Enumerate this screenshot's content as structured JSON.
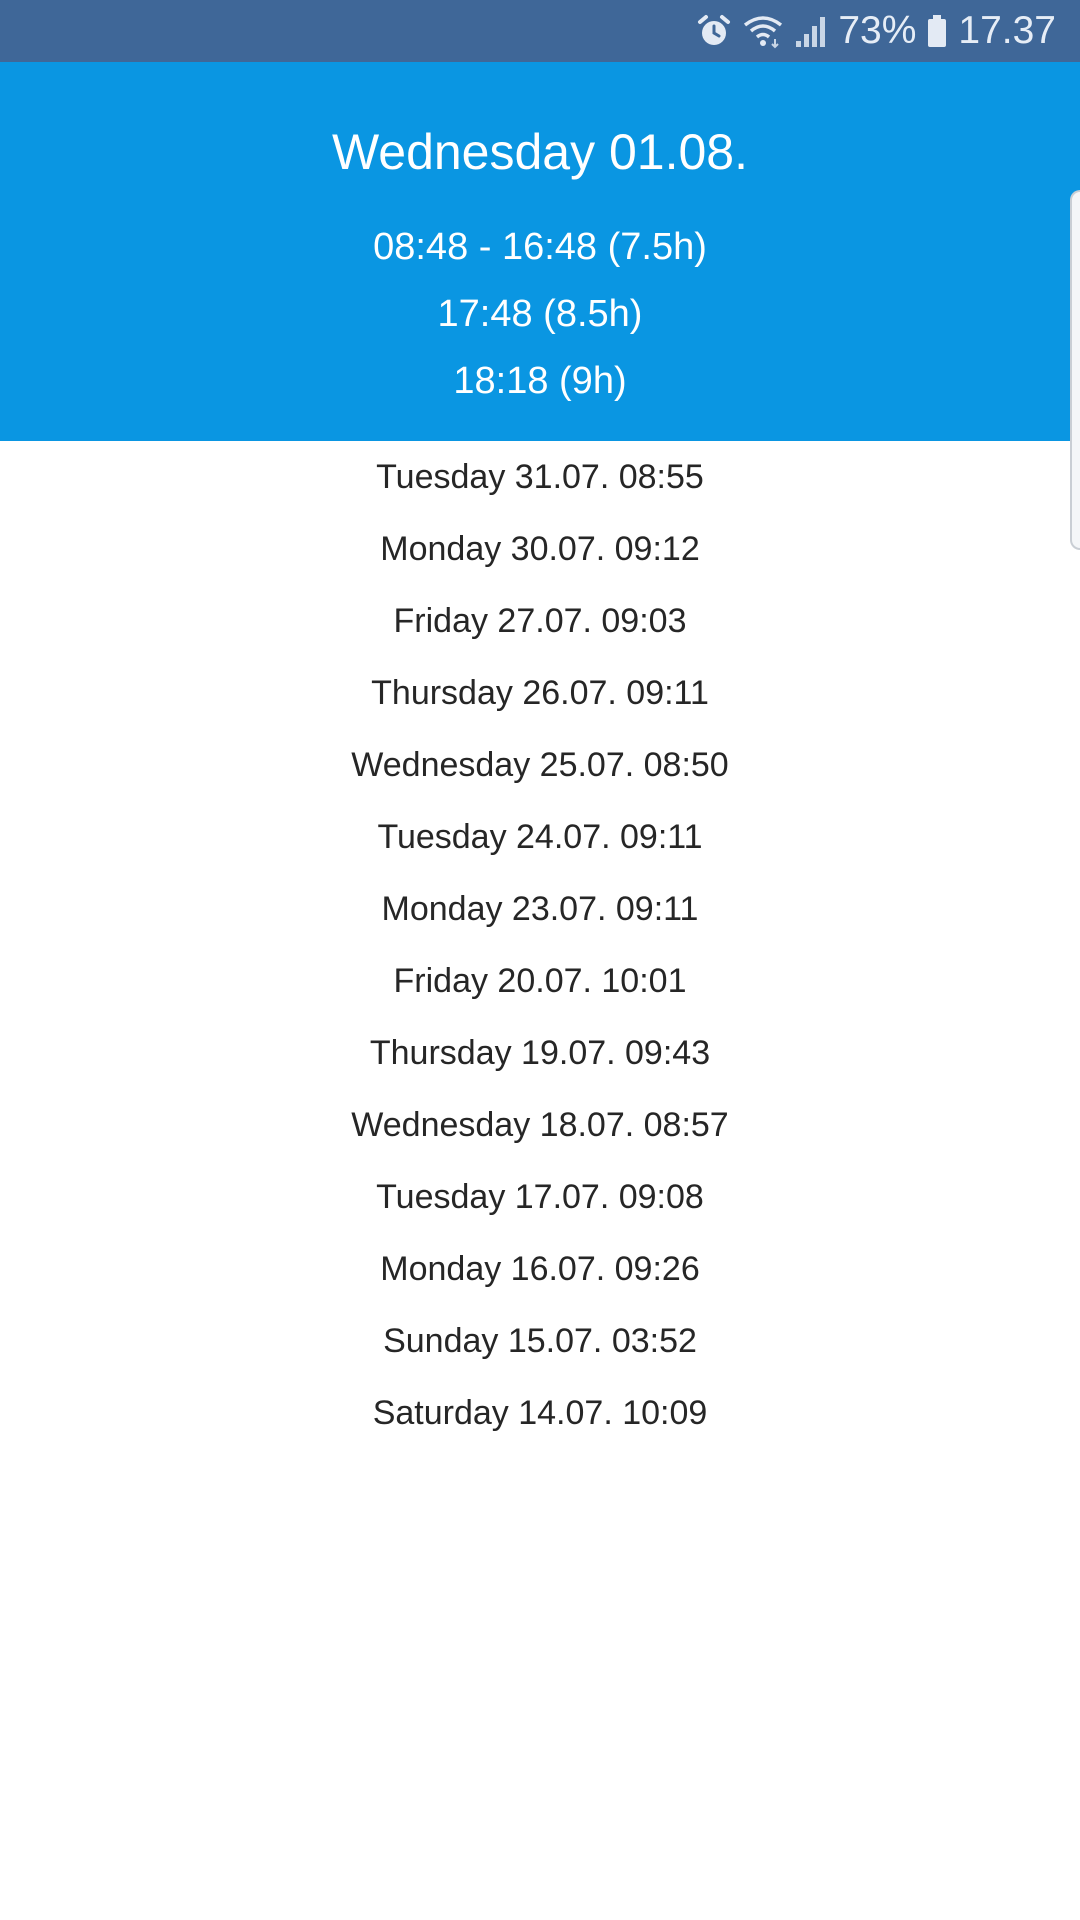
{
  "status_bar": {
    "battery_percent": "73%",
    "time": "17.37",
    "icons": [
      "alarm-icon",
      "wifi-icon",
      "signal-icon",
      "battery-icon"
    ]
  },
  "header": {
    "title": "Wednesday 01.08.",
    "lines": [
      "08:48 - 16:48 (7.5h)",
      "17:48 (8.5h)",
      "18:18 (9h)"
    ]
  },
  "history": [
    "Tuesday 31.07. 08:55",
    "Monday 30.07. 09:12",
    "Friday 27.07. 09:03",
    "Thursday 26.07. 09:11",
    "Wednesday 25.07. 08:50",
    "Tuesday 24.07. 09:11",
    "Monday 23.07. 09:11",
    "Friday 20.07. 10:01",
    "Thursday 19.07. 09:43",
    "Wednesday 18.07. 08:57",
    "Tuesday 17.07. 09:08",
    "Monday 16.07. 09:26",
    "Sunday 15.07. 03:52",
    "Saturday 14.07. 10:09"
  ],
  "colors": {
    "status_bar": "#3f6798",
    "header": "#0a96e2",
    "list_text": "#262626"
  }
}
